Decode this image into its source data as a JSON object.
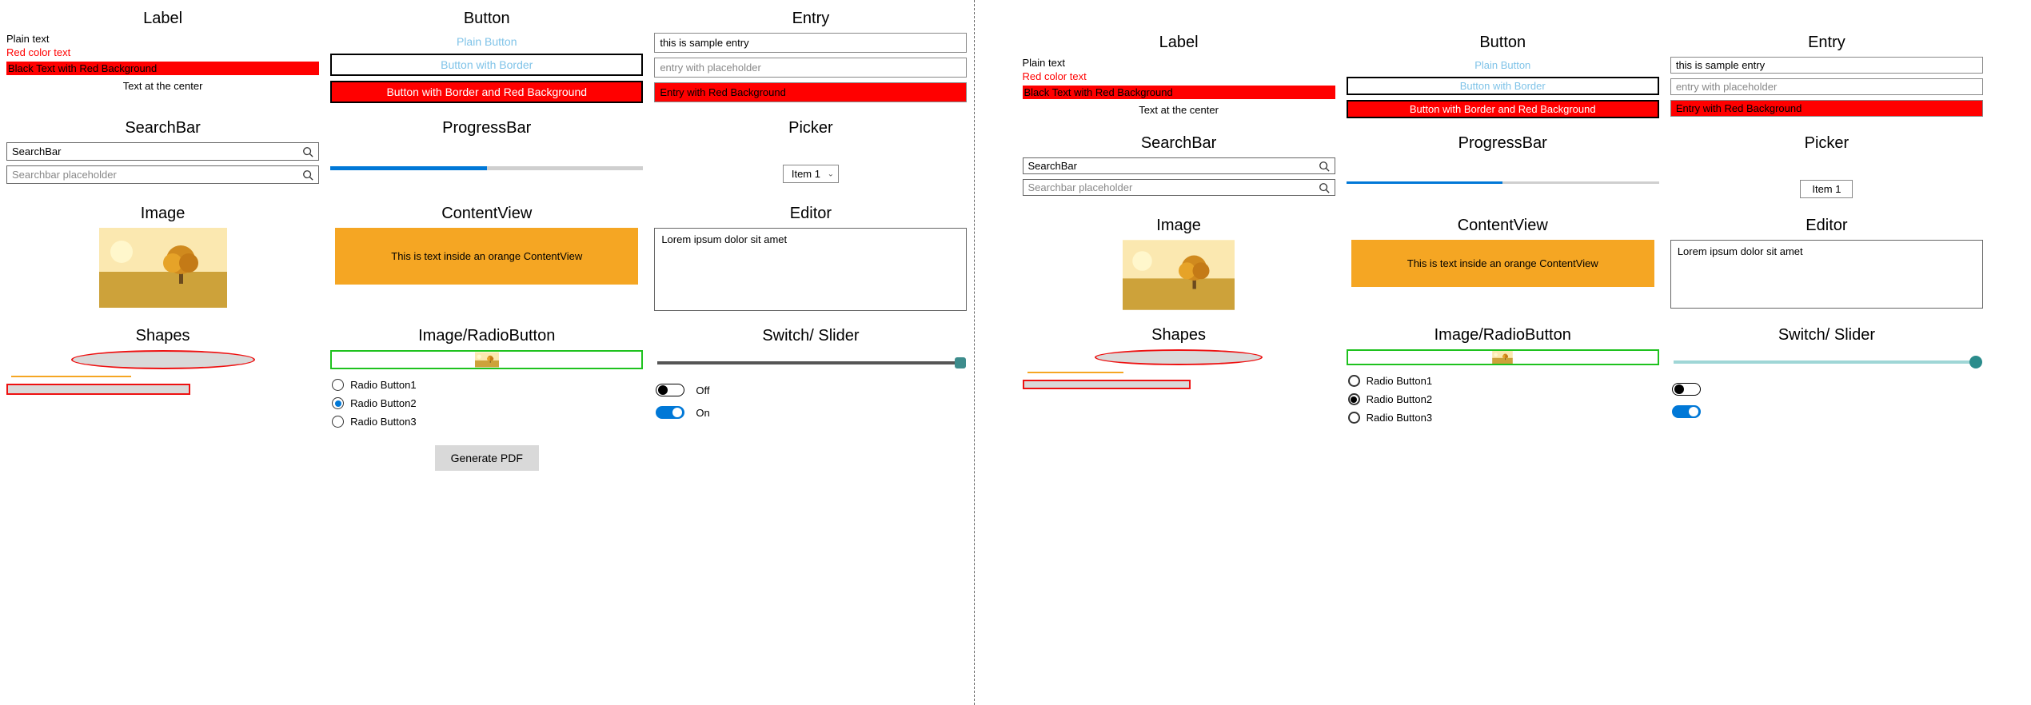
{
  "headings": {
    "label": "Label",
    "button": "Button",
    "entry": "Entry",
    "searchbar": "SearchBar",
    "progressbar": "ProgressBar",
    "picker": "Picker",
    "image": "Image",
    "contentview": "ContentView",
    "editor": "Editor",
    "shapes": "Shapes",
    "imgradio": "Image/RadioButton",
    "switchslider": "Switch/ Slider"
  },
  "label_col": {
    "plain": "Plain text",
    "red": "Red color text",
    "blackred": "Black Text with Red Background",
    "center": "Text at the center"
  },
  "button_col": {
    "plain": "Plain Button",
    "border": "Button with Border",
    "border_red": "Button with Border and Red Background"
  },
  "entry_col": {
    "sample": "this is sample entry",
    "placeholder": "entry with placeholder",
    "redbg": "Entry with Red Background"
  },
  "search": {
    "value": "SearchBar",
    "placeholder": "Searchbar placeholder"
  },
  "picker_selected": "Item 1",
  "contentview_text": "This is text inside an orange ContentView",
  "editor_text": "Lorem ipsum dolor sit amet",
  "radio": {
    "r1": "Radio Button1",
    "r2": "Radio Button2",
    "r3": "Radio Button3",
    "selected": "r2"
  },
  "switch": {
    "off_label": "Off",
    "on_label": "On"
  },
  "generate_pdf": "Generate PDF",
  "progress_value": 50,
  "slider_value": 100,
  "colors": {
    "red": "#ff0000",
    "orange": "#f5a623",
    "blue": "#0078d7",
    "green_border": "#1ec21e",
    "teal": "#2b8c8c"
  }
}
